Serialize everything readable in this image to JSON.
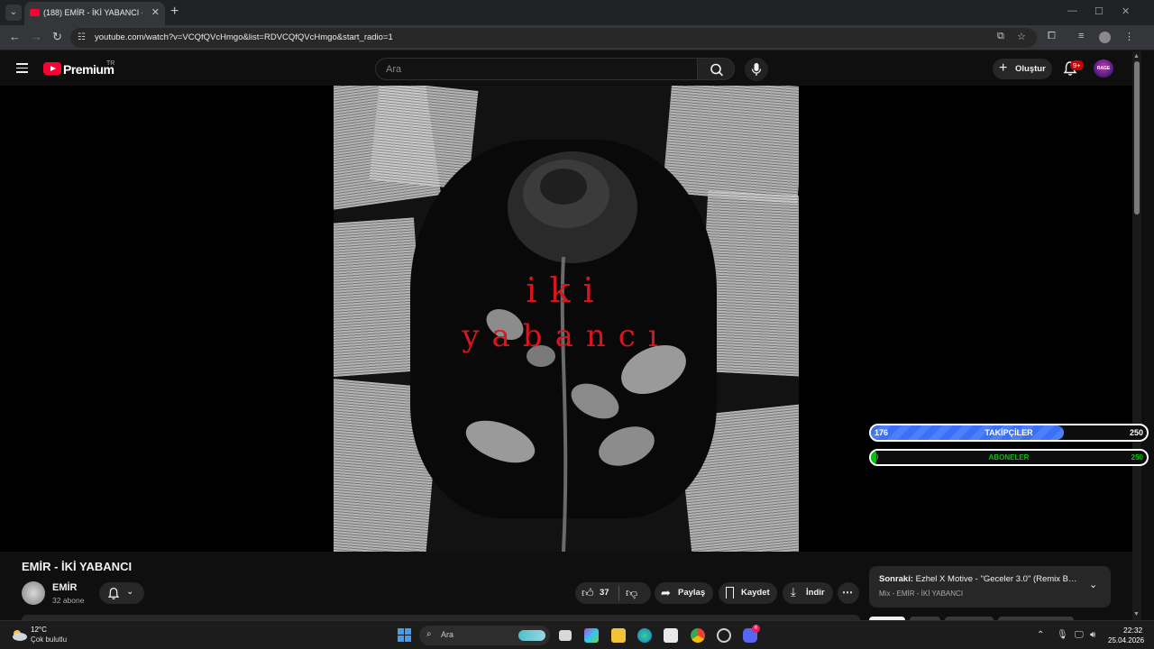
{
  "browser": {
    "tab_title": "(188) EMİR - İKİ YABANCI - YouTube",
    "url": "youtube.com/watch?v=VCQfQVcHmgo&list=RDVCQfQVcHmgo&start_radio=1"
  },
  "header": {
    "logo_text": "Premium",
    "country_code": "TR",
    "search_placeholder": "Ara",
    "create_label": "Oluştur",
    "notification_count": "9+",
    "avatar_text": "RAGE"
  },
  "artwork": {
    "line1": "iki",
    "line2": "yabancı"
  },
  "overlays": {
    "followers": {
      "label": "TAKİPÇİLER",
      "current": "176",
      "goal": "250",
      "progress": 0.7,
      "color": "#3a6ff7"
    },
    "subscribers": {
      "label": "ABONELER",
      "current": "0",
      "goal": "250",
      "progress": 0.0,
      "color": "#00c40a"
    }
  },
  "video": {
    "title": "EMİR - İKİ YABANCI",
    "channel_name": "EMİR",
    "channel_subs": "32 abone",
    "like_count": "37",
    "share_label": "Paylaş",
    "save_label": "Kaydet",
    "download_label": "İndir"
  },
  "next_up": {
    "prefix": "Sonraki:",
    "title": " Ezhel X Motive - \"Geceler 3.0\" (Remix By T...",
    "subtitle": "Mix - EMİR - İKİ YABANCI"
  },
  "taskbar": {
    "temperature": "12°C",
    "weather_desc": "Çok bulutlu",
    "search_placeholder": "Ara",
    "time": "22:32",
    "date": "25.04.2026",
    "discord_badge": "6"
  }
}
